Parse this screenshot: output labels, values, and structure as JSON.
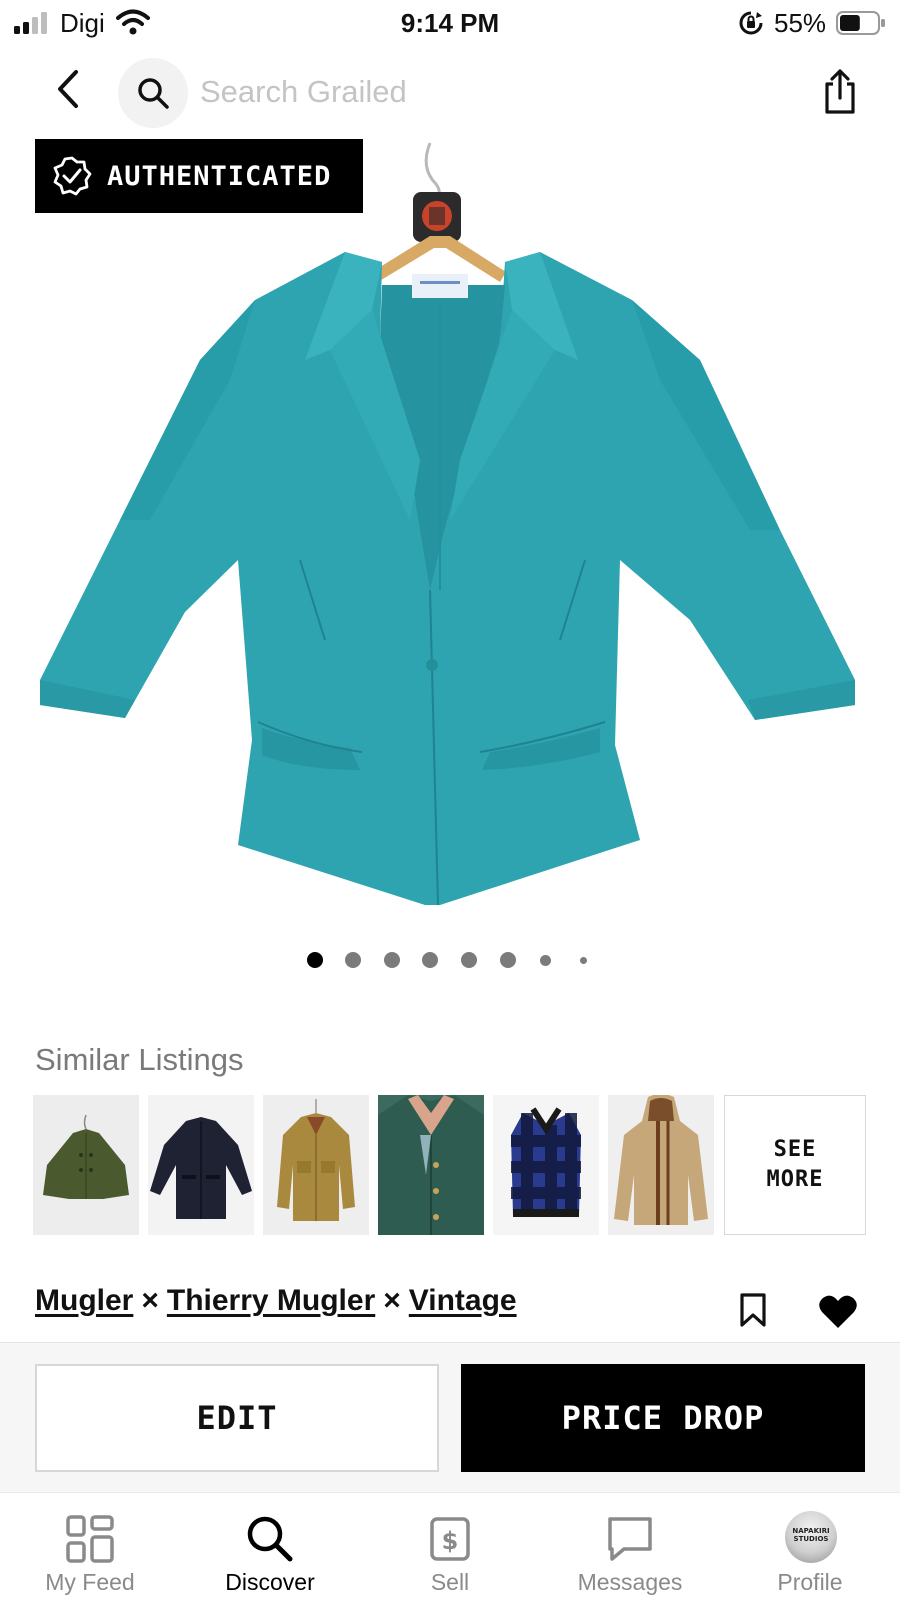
{
  "status_bar": {
    "carrier": "Digi",
    "time": "9:14 PM",
    "battery_percent": "55%",
    "battery_level": 0.55,
    "signal_bars": 2
  },
  "header": {
    "back_icon": "chevron-left-icon",
    "search_icon": "search-icon",
    "search_placeholder": "Search Grailed",
    "search_value": "",
    "share_icon": "share-icon"
  },
  "product": {
    "auth_badge": "AUTHENTICATED",
    "image_count": 8,
    "current_image": 1,
    "garment_color": "#2ea4b0"
  },
  "similar": {
    "title": "Similar Listings",
    "see_more": "SEE\nMORE"
  },
  "designers": {
    "items": [
      "Mugler",
      "Thierry Mugler",
      "Vintage"
    ],
    "separator": "×"
  },
  "actions": {
    "edit_label": "EDIT",
    "price_drop_label": "PRICE DROP"
  },
  "tab_bar": {
    "tabs": [
      {
        "label": "My Feed",
        "icon": "feed-grid-icon",
        "active": false
      },
      {
        "label": "Discover",
        "icon": "search-icon",
        "active": true
      },
      {
        "label": "Sell",
        "icon": "dollar-tag-icon",
        "active": false
      },
      {
        "label": "Messages",
        "icon": "chat-bubble-icon",
        "active": false
      },
      {
        "label": "Profile",
        "icon": "avatar",
        "active": false
      }
    ],
    "avatar_text": "NAPAKIRI\nSTUDIOS"
  }
}
